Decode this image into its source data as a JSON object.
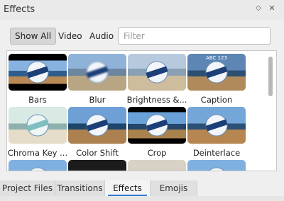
{
  "window": {
    "title": "Effects"
  },
  "title_buttons": {
    "float_icon": "◇",
    "close_icon": "✕"
  },
  "filters": {
    "show_all": "Show All",
    "video": "Video",
    "audio": "Audio",
    "placeholder": "Filter",
    "value": ""
  },
  "effects": [
    {
      "label": "Bars",
      "style": "bars"
    },
    {
      "label": "Blur",
      "style": "blur"
    },
    {
      "label": "Brightness &...",
      "style": "bright"
    },
    {
      "label": "Caption",
      "style": "caption",
      "overlay": "ABC 123"
    },
    {
      "label": "Chroma Key ...",
      "style": "chroma"
    },
    {
      "label": "Color Shift",
      "style": "shift"
    },
    {
      "label": "Crop",
      "style": "crop"
    },
    {
      "label": "Deinterlace",
      "style": "deint"
    },
    {
      "label": "",
      "style": "plain"
    },
    {
      "label": "",
      "style": "dark"
    },
    {
      "label": "",
      "style": "desert"
    },
    {
      "label": "",
      "style": "plain"
    }
  ],
  "tabs": [
    {
      "label": "Project Files",
      "active": false
    },
    {
      "label": "Transitions",
      "active": false
    },
    {
      "label": "Effects",
      "active": true
    },
    {
      "label": "Emojis",
      "active": false
    }
  ],
  "colors": {
    "accent": "#2f7ccf"
  }
}
